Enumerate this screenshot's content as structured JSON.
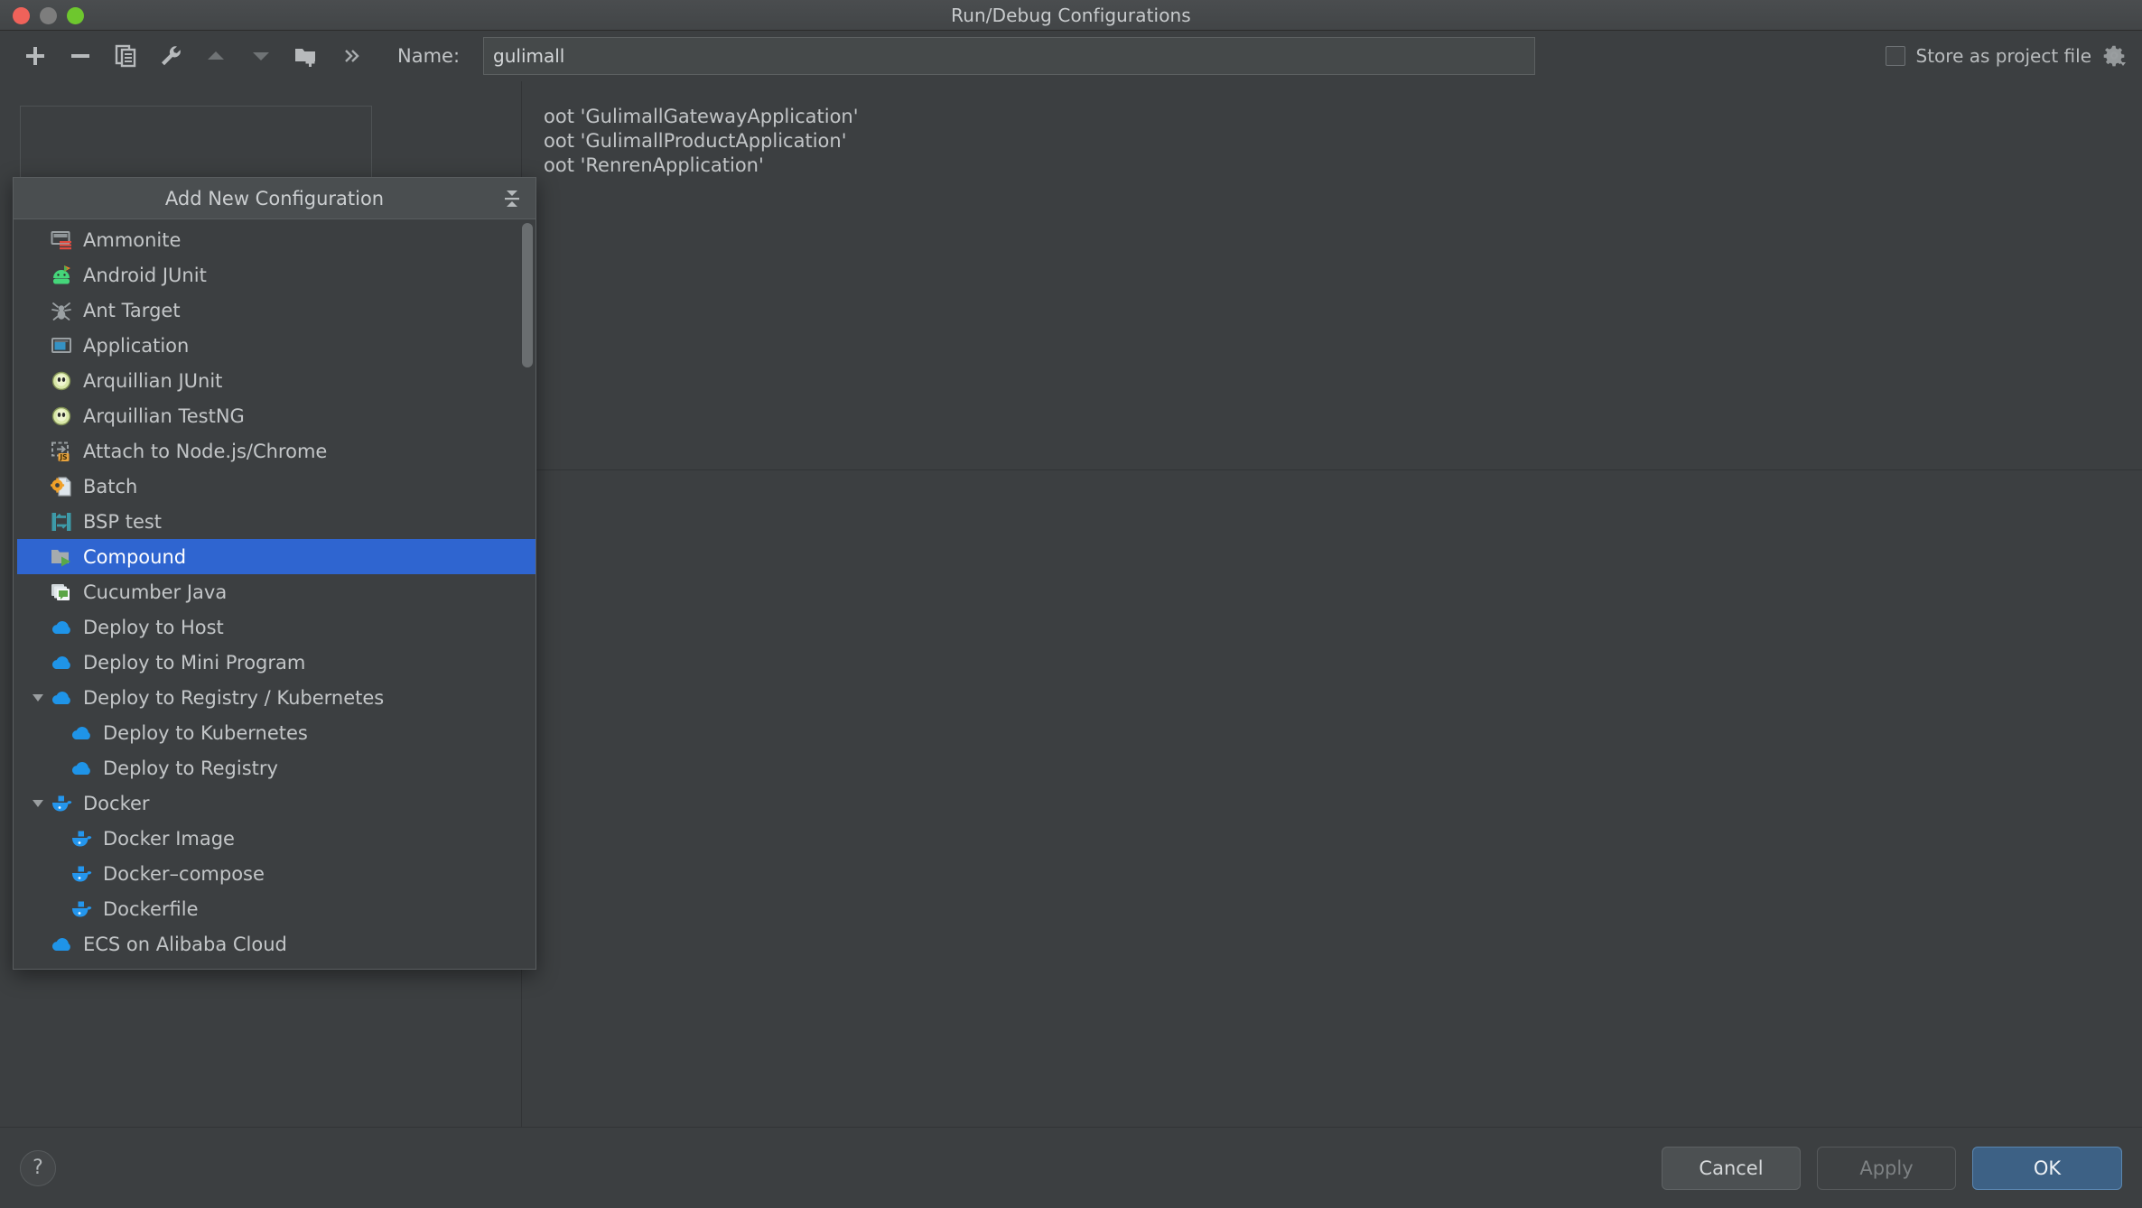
{
  "window": {
    "title": "Run/Debug Configurations",
    "traffic_lights": [
      "close",
      "minimize",
      "zoom"
    ]
  },
  "toolbar": {
    "buttons": [
      {
        "name": "add-configuration-button",
        "icon": "plus-icon",
        "label": "+"
      },
      {
        "name": "remove-configuration-button",
        "icon": "minus-icon",
        "label": "−"
      },
      {
        "name": "copy-configuration-button",
        "icon": "copy-icon",
        "label": "Copy"
      },
      {
        "name": "edit-templates-button",
        "icon": "wrench-icon",
        "label": "Edit Templates"
      },
      {
        "name": "move-up-button",
        "icon": "triangle-up-icon",
        "label": "Move Up"
      },
      {
        "name": "move-down-button",
        "icon": "triangle-down-icon",
        "label": "Move Down"
      },
      {
        "name": "move-into-folder-button",
        "icon": "folder-add-icon",
        "label": "Create Folder"
      },
      {
        "name": "more-actions-button",
        "icon": "chevron-double-right-icon",
        "label": "»"
      }
    ],
    "name_label": "Name:",
    "name_value": "gulimall",
    "name_placeholder": "Name",
    "store_as_project_file_label": "Store as project file",
    "store_as_project_file_checked": false,
    "gear_icon": "gear-icon"
  },
  "popup": {
    "title": "Add New Configuration",
    "collapse_icon": "collapse-all-icon",
    "items": [
      {
        "label": "Ammonite",
        "icon": "ammonite-icon",
        "level": 0,
        "expandable": false,
        "selected": false
      },
      {
        "label": "Android JUnit",
        "icon": "android-junit-icon",
        "level": 0,
        "expandable": false,
        "selected": false
      },
      {
        "label": "Ant Target",
        "icon": "ant-icon",
        "level": 0,
        "expandable": false,
        "selected": false
      },
      {
        "label": "Application",
        "icon": "application-icon",
        "level": 0,
        "expandable": false,
        "selected": false
      },
      {
        "label": "Arquillian JUnit",
        "icon": "arquillian-icon",
        "level": 0,
        "expandable": false,
        "selected": false
      },
      {
        "label": "Arquillian TestNG",
        "icon": "arquillian-icon",
        "level": 0,
        "expandable": false,
        "selected": false
      },
      {
        "label": "Attach to Node.js/Chrome",
        "icon": "attach-js-icon",
        "level": 0,
        "expandable": false,
        "selected": false
      },
      {
        "label": "Batch",
        "icon": "batch-icon",
        "level": 0,
        "expandable": false,
        "selected": false
      },
      {
        "label": "BSP test",
        "icon": "bsp-test-icon",
        "level": 0,
        "expandable": false,
        "selected": false
      },
      {
        "label": "Compound",
        "icon": "compound-icon",
        "level": 0,
        "expandable": false,
        "selected": true
      },
      {
        "label": "Cucumber Java",
        "icon": "cucumber-icon",
        "level": 0,
        "expandable": false,
        "selected": false
      },
      {
        "label": "Deploy to Host",
        "icon": "cloud-upload-icon",
        "level": 0,
        "expandable": false,
        "selected": false
      },
      {
        "label": "Deploy to Mini Program",
        "icon": "cloud-upload-icon",
        "level": 0,
        "expandable": false,
        "selected": false
      },
      {
        "label": "Deploy to Registry / Kubernetes",
        "icon": "cloud-upload-icon",
        "level": 0,
        "expandable": true,
        "selected": false
      },
      {
        "label": "Deploy to Kubernetes",
        "icon": "cloud-upload-icon",
        "level": 1,
        "expandable": false,
        "selected": false
      },
      {
        "label": "Deploy to Registry",
        "icon": "cloud-upload-icon",
        "level": 1,
        "expandable": false,
        "selected": false
      },
      {
        "label": "Docker",
        "icon": "docker-icon",
        "level": 0,
        "expandable": true,
        "selected": false
      },
      {
        "label": "Docker Image",
        "icon": "docker-icon",
        "level": 1,
        "expandable": false,
        "selected": false
      },
      {
        "label": "Docker–compose",
        "icon": "docker-icon",
        "level": 1,
        "expandable": false,
        "selected": false
      },
      {
        "label": "Dockerfile",
        "icon": "docker-icon",
        "level": 1,
        "expandable": false,
        "selected": false
      },
      {
        "label": "ECS on Alibaba Cloud",
        "icon": "cloud-upload-icon",
        "level": 0,
        "expandable": false,
        "selected": false
      }
    ]
  },
  "background_list": {
    "rows": [
      "oot 'GulimallGatewayApplication'",
      "oot 'GulimallProductApplication'",
      "oot 'RenrenApplication'"
    ]
  },
  "footer": {
    "help_label": "?",
    "cancel_label": "Cancel",
    "apply_label": "Apply",
    "apply_enabled": false,
    "ok_label": "OK"
  },
  "colors": {
    "background": "#3c3f41",
    "selection_blue": "#2f65d0",
    "primary_button": "#3d6185",
    "docker_blue": "#2496ed",
    "text": "#c3c6c8"
  }
}
